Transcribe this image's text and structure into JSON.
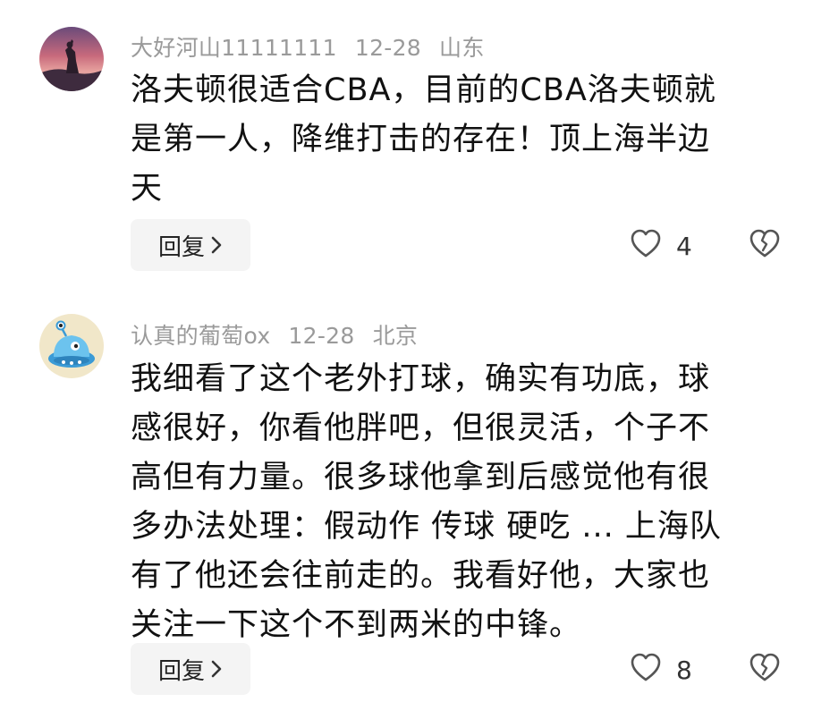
{
  "comments": [
    {
      "username": "大好河山11111111",
      "date": "12-28",
      "location": "山东",
      "text": "洛夫顿很适合CBA，目前的CBA洛夫顿就\n是第一人，降维打击的存在！顶上海半边\n天",
      "reply_label": "回复",
      "like_count": "4",
      "avatar_icon": "silhouette-sunset-avatar",
      "like_icon": "heart-outline-icon",
      "dislike_icon": "broken-heart-icon"
    },
    {
      "username": "认真的葡萄ox",
      "date": "12-28",
      "location": "北京",
      "text": "我细看了这个老外打球，确实有功底，球\n感很好，你看他胖吧，但很灵活，个子不\n高但有力量。很多球他拿到后感觉他有很\n多办法处理：假动作 传球 硬吃 ... 上海队\n有了他还会往前走的。我看好他，大家也\n关注一下这个不到两米的中锋。",
      "reply_label": "回复",
      "like_count": "8",
      "avatar_icon": "blue-alien-ufo-avatar",
      "like_icon": "heart-outline-icon",
      "dislike_icon": "broken-heart-icon"
    }
  ],
  "colors": {
    "meta_text": "#9a9a9a",
    "body_text": "#111111",
    "reply_bg": "#f4f4f4",
    "icon_stroke": "#555555"
  }
}
